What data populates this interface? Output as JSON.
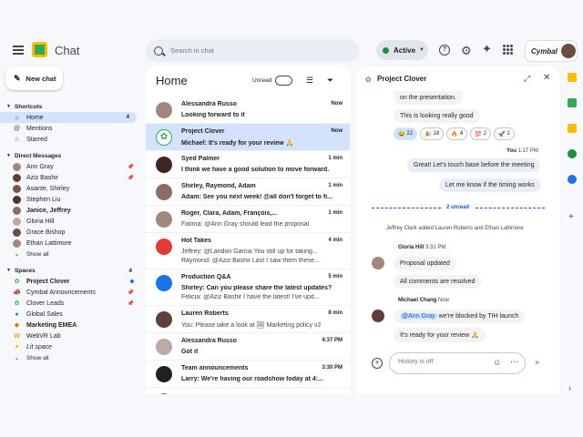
{
  "app": {
    "title": "Chat"
  },
  "search": {
    "placeholder": "Search in chat"
  },
  "status": {
    "label": "Active"
  },
  "brand": {
    "name": "Cymbal"
  },
  "new_chat": {
    "label": "New chat"
  },
  "nav": {
    "shortcuts": {
      "title": "Shortcuts",
      "items": [
        {
          "label": "Home",
          "count": "4",
          "icon": "home-icon"
        },
        {
          "label": "Mentions",
          "icon": "at-icon"
        },
        {
          "label": "Starred",
          "icon": "star-icon"
        }
      ]
    },
    "dms": {
      "title": "Direct Messages",
      "items": [
        {
          "label": "Ann Gray",
          "pinned": true
        },
        {
          "label": "Aziz Bashir",
          "pinned": true
        },
        {
          "label": "Asante, Shirley"
        },
        {
          "label": "Stephen Liu"
        },
        {
          "label": "Janice, Jeffrey",
          "bold": true
        },
        {
          "label": "Gloria Hill"
        },
        {
          "label": "Grace Bishop"
        },
        {
          "label": "Ethan Lattimore"
        }
      ],
      "show_all": "Show all"
    },
    "spaces": {
      "title": "Spaces",
      "count": "4",
      "items": [
        {
          "label": "Project Clover",
          "bold": true
        },
        {
          "label": "Cymbal Announcements"
        },
        {
          "label": "Clover Leads"
        },
        {
          "label": "Global Sales"
        },
        {
          "label": "Marketing EMEA",
          "bold": true
        },
        {
          "label": "WebVR Lab"
        },
        {
          "label": "Lit space",
          "italic": true
        }
      ],
      "show_all": "Show all"
    }
  },
  "home": {
    "title": "Home",
    "unread_label": "Unread",
    "rows": [
      {
        "name": "Alessandra Russo",
        "time": "Now",
        "preview": "Looking forward to it",
        "bold": true,
        "color": "#a1887f"
      },
      {
        "name": "Project Clover",
        "time": "Now",
        "preview": "Michael: It's ready for your review 🙏",
        "bold": true,
        "color": "#ffffff"
      },
      {
        "name": "Syed Palmer",
        "time": "1 min",
        "preview": "I think we have a good solution to move forward.",
        "bold": true,
        "color": "#3e2723"
      },
      {
        "name": "Shirley, Raymond, Adam",
        "time": "1 min",
        "preview": "Adam: See you next week! @all don't forget to fi...",
        "bold": true,
        "color": "#8d6e63"
      },
      {
        "name": "Roger, Clara, Adam, François,...",
        "time": "1 min",
        "preview": "Fatima: @Ann Gray should lead the proposal",
        "bold": false,
        "color": "#a1887f"
      },
      {
        "name": "Hot Takes",
        "time": "4 min",
        "preview": "Jeffrey: @Landon Garcia You still up for taking...",
        "preview2": "Raymond: @Aziz Bashir Last I saw them these...",
        "bold": false,
        "color": "#e53935"
      },
      {
        "name": "Production Q&A",
        "time": "5 min",
        "preview": "Shirley: Can you please share the latest updates?",
        "preview2": "Felicia: @Aziz Bashir I have the latest! I've upd...",
        "bold": true,
        "color": "#1a73e8"
      },
      {
        "name": "Lauren Roberts",
        "time": "8 min",
        "preview": "You: Please take a look at 🖼 Marketing policy v2",
        "bold": false,
        "color": "#5d4037"
      },
      {
        "name": "Alessandra Russo",
        "time": "4:37 PM",
        "preview": "Got it",
        "bold": true,
        "color": "#bcaaa4"
      },
      {
        "name": "Team announcements",
        "time": "3:30 PM",
        "preview": "Larry: We're having our roadshow today at 4:...",
        "bold": true,
        "color": "#212121"
      },
      {
        "name": "",
        "time": "",
        "preview": "",
        "bold": false,
        "color": "#8d6e63"
      }
    ]
  },
  "chat": {
    "title": "Project Clover",
    "msg_prev": "on the presentation.",
    "msg_looking": "This is looking really good",
    "reactions": [
      {
        "emoji": "😂",
        "count": "22",
        "selected": true
      },
      {
        "emoji": "🎉",
        "count": "18"
      },
      {
        "emoji": "🔥",
        "count": "4"
      },
      {
        "emoji": "💯",
        "count": "2"
      },
      {
        "emoji": "🚀",
        "count": "2"
      }
    ],
    "you_label": "You",
    "you_time": "1:17 PM",
    "you_msg1": "Great! Let's touch base before the meeting",
    "you_msg2": "Let me know if the timing works",
    "unread_divider": "2 unread",
    "system_msg": "Jeffrey Clark added Lauren Roberts and Ethan Lattimore",
    "gloria": {
      "name": "Gloria Hill",
      "time": "3:31 PM",
      "msg1": "Proposal updated",
      "msg2": "All comments are resolved"
    },
    "michael": {
      "name": "Michael Chang",
      "time": "Now",
      "mention": "@Ann Gray",
      "msg1_rest": "we're blocked by TIH launch",
      "msg2": "It's ready for your review 🙏"
    },
    "composer_placeholder": "History is off"
  }
}
